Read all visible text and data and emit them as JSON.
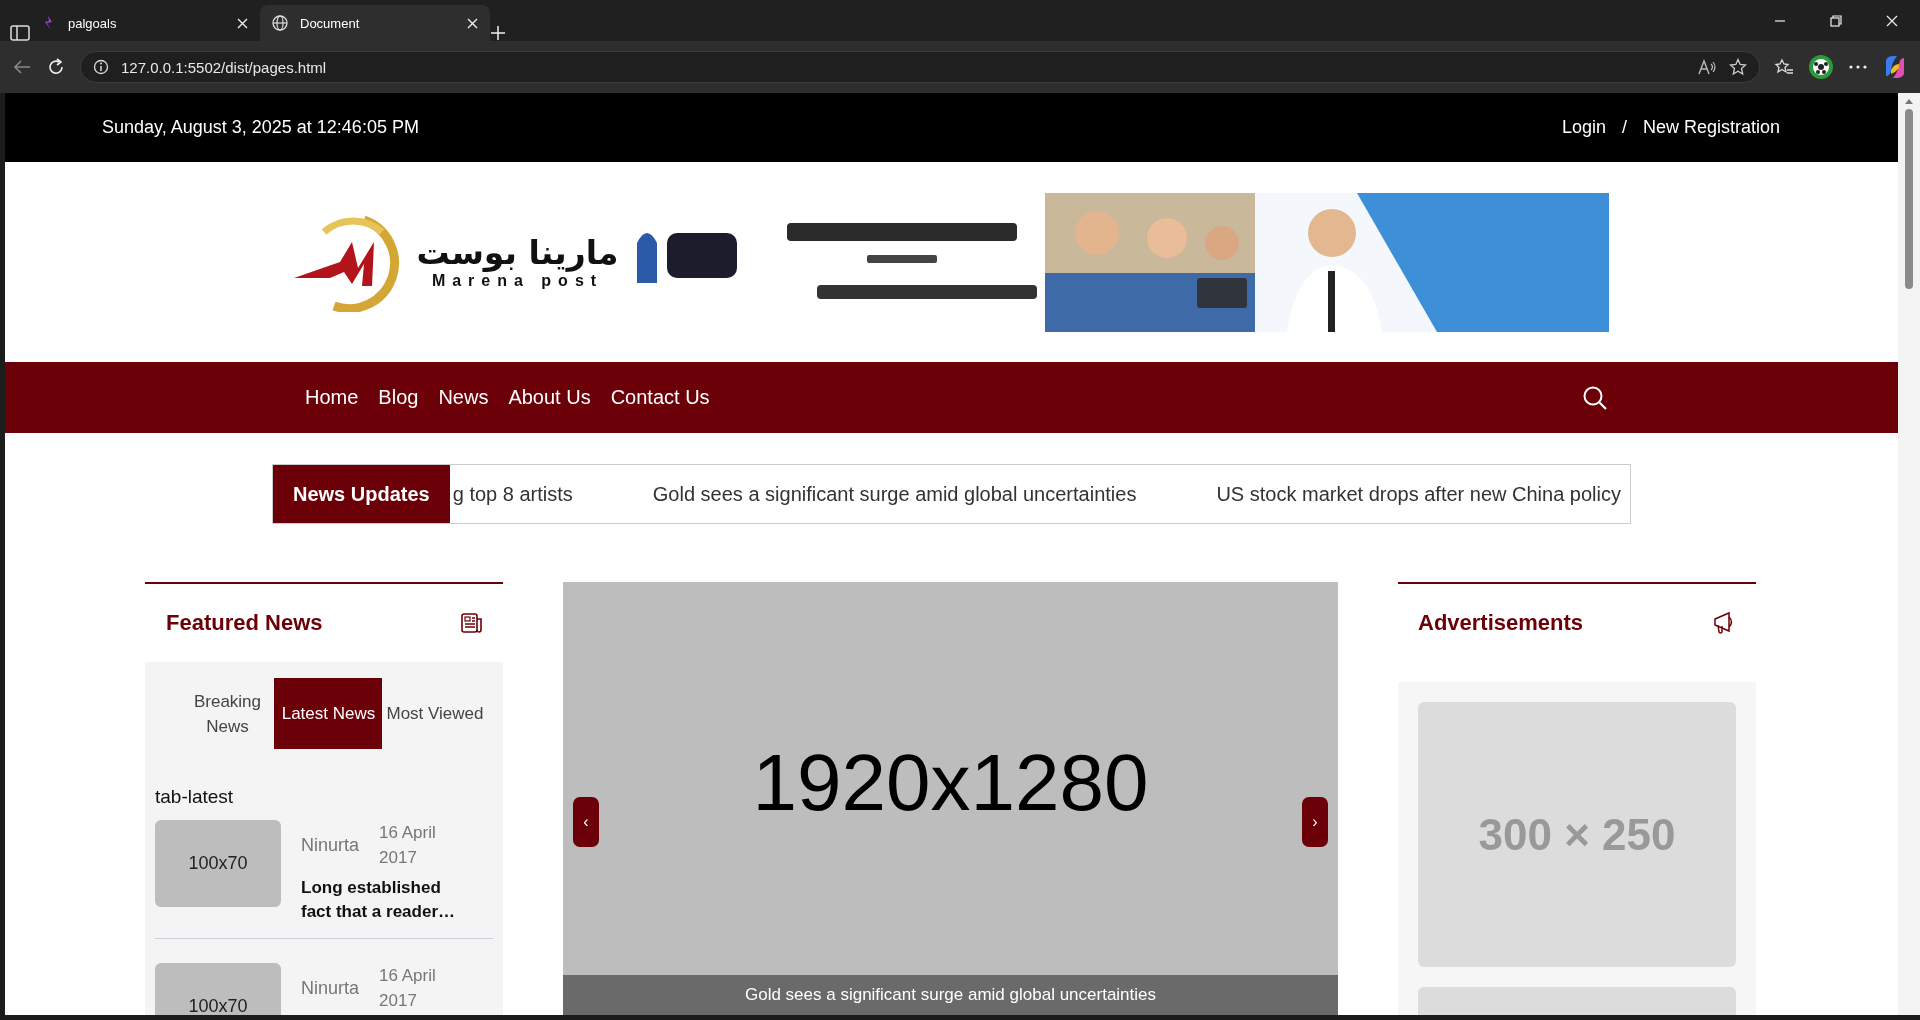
{
  "browser": {
    "tabs": [
      {
        "title": "palgoals",
        "selected": false
      },
      {
        "title": "Document",
        "selected": true
      }
    ],
    "url": "127.0.0.1:5502/dist/pages.html"
  },
  "top_bar": {
    "date": "Sunday, August 3, 2025 at 12:46:05 PM",
    "links": [
      "Login",
      "New Registration"
    ],
    "separator": "/"
  },
  "logo": {
    "arabic": "مارينا بوست",
    "latin": "Marena post"
  },
  "nav": {
    "items": [
      "Home",
      "Blog",
      "News",
      "About Us",
      "Contact Us"
    ]
  },
  "ticker": {
    "label": "News Updates",
    "items": [
      "g top 8 artists",
      "Gold sees a significant surge amid global uncertainties",
      "US stock market drops after new China policy"
    ]
  },
  "featured": {
    "title": "Featured News",
    "tabs": [
      {
        "label": "Breaking News",
        "selected": false
      },
      {
        "label": "Latest News",
        "selected": true
      },
      {
        "label": "Most Viewed",
        "selected": false
      }
    ],
    "pane_label": "tab-latest",
    "items": [
      {
        "thumb": "100x70",
        "author": "Ninurta",
        "date": "16 April 2017",
        "title": "Long established fact that a reader…"
      },
      {
        "thumb": "100x70",
        "author": "Ninurta",
        "date": "16 April 2017"
      }
    ]
  },
  "slider": {
    "placeholder": "1920x1280",
    "caption": "Gold sees a significant surge amid global uncertainties",
    "prev": "‹",
    "next": "›"
  },
  "ads": {
    "title": "Advertisements",
    "slots": [
      {
        "kind": "labeled",
        "label": "300 × 250"
      },
      {
        "kind": "blank"
      }
    ]
  }
}
